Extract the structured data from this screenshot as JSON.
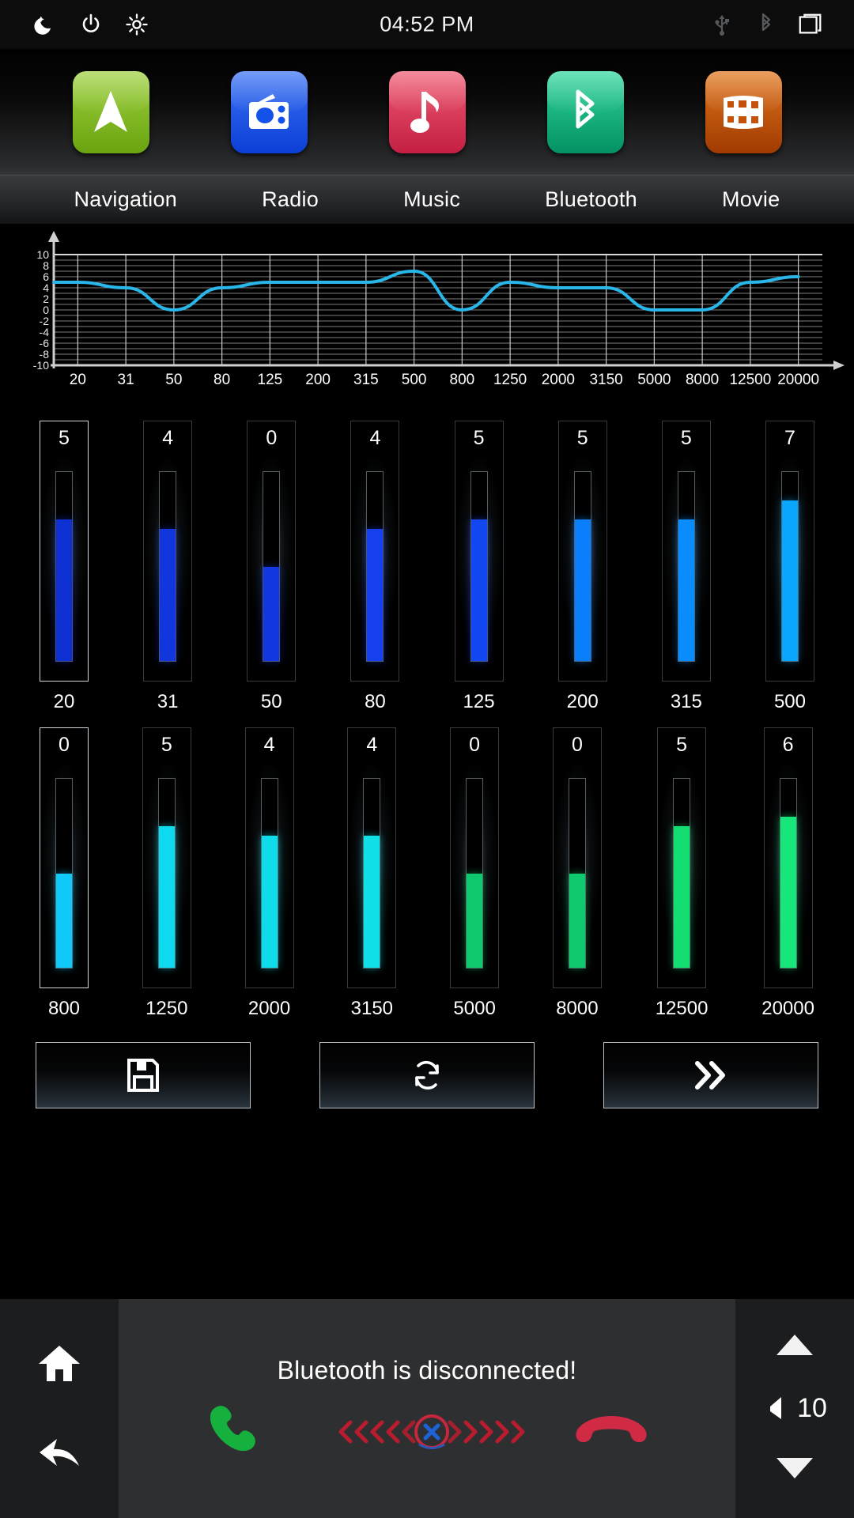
{
  "status_bar": {
    "time": "04:52 PM",
    "left_icons": [
      "night-mode-icon",
      "power-icon",
      "brightness-icon"
    ],
    "right_icons": [
      "usb-icon",
      "bluetooth-icon",
      "screen-icon"
    ]
  },
  "dock": {
    "apps": [
      {
        "label": "Navigation",
        "icon": "navigation-arrow-icon",
        "color": "#7cb518"
      },
      {
        "label": "Radio",
        "icon": "radio-icon",
        "color": "#1352e8"
      },
      {
        "label": "Music",
        "icon": "music-note-icon",
        "color": "#d93a56"
      },
      {
        "label": "Bluetooth",
        "icon": "bluetooth-icon",
        "color": "#10a272"
      },
      {
        "label": "Movie",
        "icon": "film-strip-icon",
        "color": "#c4520a"
      }
    ]
  },
  "chart_data": {
    "type": "line",
    "title": "",
    "xlabel": "",
    "ylabel": "",
    "grid": true,
    "legend": "none",
    "line_color": "#29b6e8",
    "ylim": [
      -10,
      10
    ],
    "ytick_labels": [
      "10",
      "8",
      "6",
      "4",
      "2",
      "0",
      "-2",
      "-4",
      "-6",
      "-8",
      "-10"
    ],
    "yticks": [
      10,
      8,
      6,
      4,
      2,
      0,
      -2,
      -4,
      -6,
      -8,
      -10
    ],
    "categories": [
      "20",
      "31",
      "50",
      "80",
      "125",
      "200",
      "315",
      "500",
      "800",
      "1250",
      "2000",
      "3150",
      "5000",
      "8000",
      "12500",
      "20000"
    ],
    "x": [
      20,
      31,
      50,
      80,
      125,
      200,
      315,
      500,
      800,
      1250,
      2000,
      3150,
      5000,
      8000,
      12500,
      20000
    ],
    "values": [
      5,
      4,
      0,
      4,
      5,
      5,
      5,
      7,
      0,
      5,
      4,
      4,
      0,
      0,
      5,
      6
    ]
  },
  "equalizer": {
    "row1": [
      {
        "value": "5",
        "freq": "20",
        "level": 5,
        "color": "#0e2fd1",
        "selected": true
      },
      {
        "value": "4",
        "freq": "31",
        "level": 4,
        "color": "#1136dc",
        "selected": false
      },
      {
        "value": "0",
        "freq": "50",
        "level": 0,
        "color": "#1338e2",
        "selected": false
      },
      {
        "value": "4",
        "freq": "80",
        "level": 4,
        "color": "#1540ec",
        "selected": false
      },
      {
        "value": "5",
        "freq": "125",
        "level": 5,
        "color": "#1247f2",
        "selected": false
      },
      {
        "value": "5",
        "freq": "200",
        "level": 5,
        "color": "#0b7ffb",
        "selected": false
      },
      {
        "value": "5",
        "freq": "315",
        "level": 5,
        "color": "#0a8cfd",
        "selected": false
      },
      {
        "value": "7",
        "freq": "500",
        "level": 7,
        "color": "#09a6fd",
        "selected": false
      }
    ],
    "row2": [
      {
        "value": "0",
        "freq": "800",
        "level": 0,
        "color": "#0fc9f8",
        "selected": true
      },
      {
        "value": "5",
        "freq": "1250",
        "level": 5,
        "color": "#0ed9ef",
        "selected": false
      },
      {
        "value": "4",
        "freq": "2000",
        "level": 4,
        "color": "#0fdcea",
        "selected": false
      },
      {
        "value": "4",
        "freq": "3150",
        "level": 4,
        "color": "#11e0e6",
        "selected": false
      },
      {
        "value": "0",
        "freq": "5000",
        "level": 0,
        "color": "#10c96e",
        "selected": false
      },
      {
        "value": "0",
        "freq": "8000",
        "level": 0,
        "color": "#10c96e",
        "selected": false
      },
      {
        "value": "5",
        "freq": "12500",
        "level": 5,
        "color": "#14dd72",
        "selected": false
      },
      {
        "value": "6",
        "freq": "20000",
        "level": 6,
        "color": "#17e67a",
        "selected": false
      }
    ]
  },
  "actions": [
    {
      "name": "save",
      "icon": "floppy-disk-icon"
    },
    {
      "name": "reset",
      "icon": "refresh-icon"
    },
    {
      "name": "next",
      "icon": "double-chevron-right-icon"
    }
  ],
  "bottom_bar": {
    "home_icon": "home-icon",
    "back_icon": "back-arrow-icon",
    "message": "Bluetooth is disconnected!",
    "answer_icon": "phone-answer-icon",
    "hangup_icon": "phone-hangup-icon",
    "disconnect_icon": "disconnected-indicator-icon",
    "volume_up_icon": "volume-up-icon",
    "volume_down_icon": "volume-down-icon",
    "volume_icon": "speaker-icon",
    "volume_value": "10"
  }
}
